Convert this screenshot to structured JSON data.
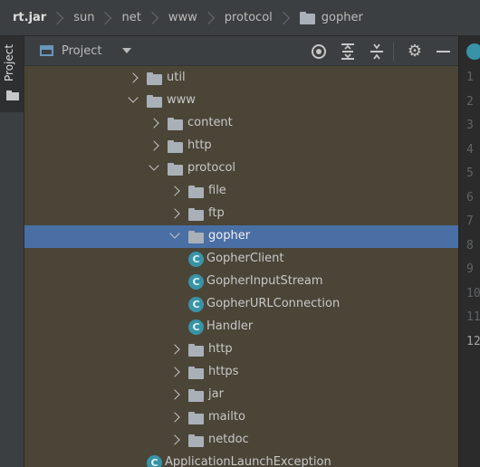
{
  "breadcrumb": [
    {
      "label": "rt.jar",
      "bold": true,
      "folder": false
    },
    {
      "label": "sun",
      "bold": false,
      "folder": false
    },
    {
      "label": "net",
      "bold": false,
      "folder": false
    },
    {
      "label": "www",
      "bold": false,
      "folder": false
    },
    {
      "label": "protocol",
      "bold": false,
      "folder": false
    },
    {
      "label": "gopher",
      "bold": false,
      "folder": true
    }
  ],
  "side_stripe": {
    "label": "Project"
  },
  "toolbar": {
    "view_label": "Project",
    "icons": [
      "locate-icon",
      "expand-all-icon",
      "collapse-all-icon",
      "gear-icon",
      "minimize-icon"
    ]
  },
  "tree": {
    "rows": [
      {
        "label": "util",
        "indent": 5,
        "state": "collapsed",
        "kind": "folder"
      },
      {
        "label": "www",
        "indent": 5,
        "state": "expanded",
        "kind": "folder"
      },
      {
        "label": "content",
        "indent": 6,
        "state": "collapsed",
        "kind": "folder"
      },
      {
        "label": "http",
        "indent": 6,
        "state": "collapsed",
        "kind": "folder"
      },
      {
        "label": "protocol",
        "indent": 6,
        "state": "expanded",
        "kind": "folder"
      },
      {
        "label": "file",
        "indent": 7,
        "state": "collapsed",
        "kind": "folder"
      },
      {
        "label": "ftp",
        "indent": 7,
        "state": "collapsed",
        "kind": "folder"
      },
      {
        "label": "gopher",
        "indent": 7,
        "state": "expanded",
        "kind": "folder",
        "selected": true
      },
      {
        "label": "GopherClient",
        "indent": 8,
        "state": "none",
        "kind": "class"
      },
      {
        "label": "GopherInputStream",
        "indent": 8,
        "state": "none",
        "kind": "class"
      },
      {
        "label": "GopherURLConnection",
        "indent": 8,
        "state": "none",
        "kind": "class"
      },
      {
        "label": "Handler",
        "indent": 8,
        "state": "none",
        "kind": "class"
      },
      {
        "label": "http",
        "indent": 7,
        "state": "collapsed",
        "kind": "folder"
      },
      {
        "label": "https",
        "indent": 7,
        "state": "collapsed",
        "kind": "folder"
      },
      {
        "label": "jar",
        "indent": 7,
        "state": "collapsed",
        "kind": "folder"
      },
      {
        "label": "mailto",
        "indent": 7,
        "state": "collapsed",
        "kind": "folder"
      },
      {
        "label": "netdoc",
        "indent": 7,
        "state": "collapsed",
        "kind": "folder"
      },
      {
        "label": "ApplicationLaunchException",
        "indent": 6,
        "state": "none",
        "kind": "class"
      }
    ]
  },
  "editor": {
    "line_numbers": [
      "1",
      "2",
      "3",
      "4",
      "5",
      "6",
      "7",
      "8",
      "9",
      "10",
      "11",
      "12"
    ],
    "current_line": "12"
  },
  "colors": {
    "selection": "#4a6fa5",
    "tree_background": "#4a4537",
    "class_icon": "#3993a7"
  }
}
